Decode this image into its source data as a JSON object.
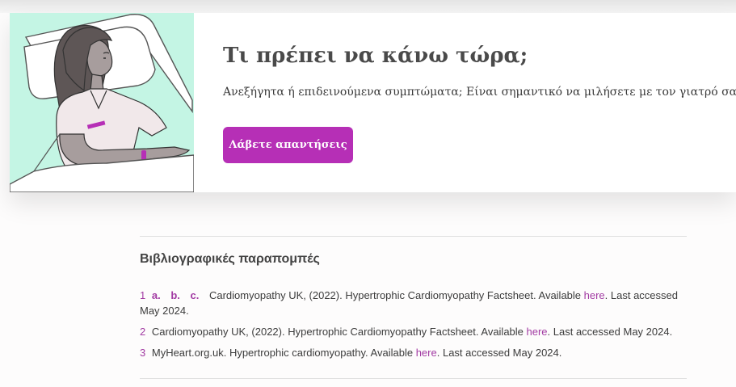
{
  "cta": {
    "title": "Τι πρέπει να κάνω τώρα;",
    "text": "Ανεξήγητα ή επιδεινούμενα συμπτώματα; Είναι σημαντικό να μιλήσετε με τον γιατρό σας.",
    "button_label": "Λάβετε απαντήσεις"
  },
  "references": {
    "title": "Βιβλιογραφικές παραπομπές",
    "items": [
      {
        "num": "1",
        "backlinks": [
          "a.",
          "b.",
          "c."
        ],
        "text_before": "Cardiomyopathy UK, (2022). Hypertrophic Cardiomyopathy Factsheet. Available ",
        "link": "here",
        "text_after": ". Last accessed May 2024."
      },
      {
        "num": "2",
        "text_before": "Cardiomyopathy UK, (2022). Hypertrophic Cardiomyopathy Factsheet. Available ",
        "link": "here",
        "text_after": ". Last accessed May 2024."
      },
      {
        "num": "3",
        "text_before": "MyHeart.org.uk. Hypertrophic cardiomyopathy. Available ",
        "link": "here",
        "text_after": ". Last accessed May 2024."
      }
    ]
  },
  "colors": {
    "accent": "#b62fb6",
    "illustration_bg": "#c4f5e4"
  },
  "illustration": {
    "icon": "patient-in-hospital-bed-illustration"
  }
}
